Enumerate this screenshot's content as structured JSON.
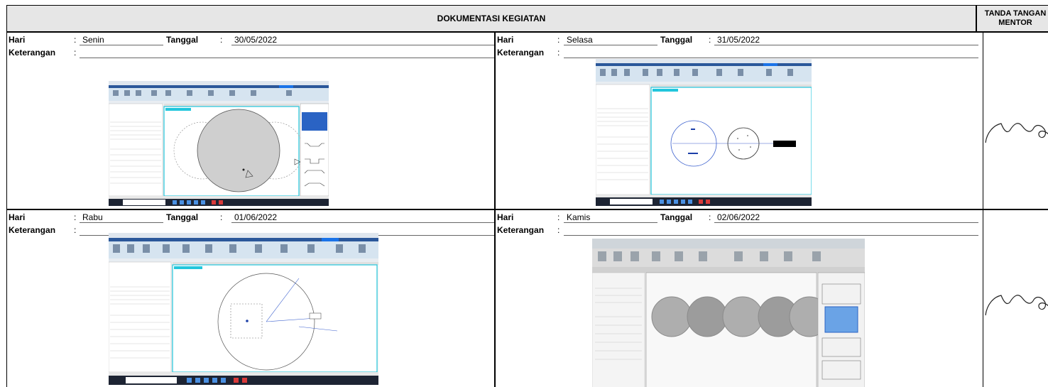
{
  "header": {
    "title": "DOKUMENTASI KEGIATAN",
    "mentor_line1": "TANDA TANGAN",
    "mentor_line2": "MENTOR"
  },
  "labels": {
    "hari": "Hari",
    "tanggal": "Tanggal",
    "keterangan": "Keterangan",
    "colon": ":"
  },
  "entries": [
    {
      "hari": "Senin",
      "tanggal": "30/05/2022",
      "keterangan": "",
      "screenshot": "revit-foundation-plan-screenshot"
    },
    {
      "hari": "Selasa",
      "tanggal": "31/05/2022",
      "keterangan": "",
      "screenshot": "revit-basement-plan-screenshot"
    },
    {
      "hari": "Rabu",
      "tanggal": "01/06/2022",
      "keterangan": "",
      "screenshot": "revit-structural-plan-screenshot"
    },
    {
      "hari": "Kamis",
      "tanggal": "02/06/2022",
      "keterangan": "",
      "screenshot": "revit-pile-section-photo"
    }
  ],
  "colors": {
    "header_bg": "#e6e6e6",
    "ribbon_bg": "#d6e4f0",
    "tab_active": "#2b579a",
    "view_border": "#22c6dc",
    "taskbar": "#1d2433"
  },
  "icons": [
    "signature-scribble",
    "revit-app-window"
  ]
}
